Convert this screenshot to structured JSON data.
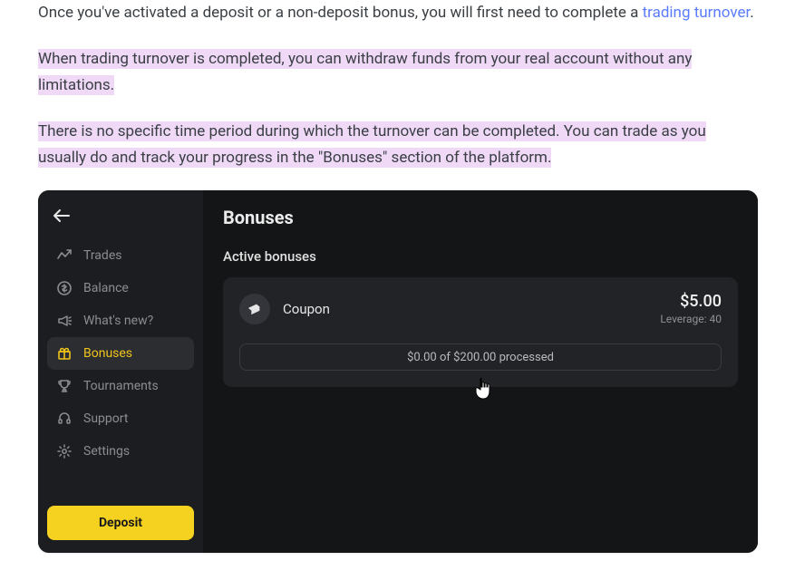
{
  "article": {
    "p1_pre": "Once you've activated a deposit or a non-deposit bonus, you will first need to complete a ",
    "p1_link": "trading turnover",
    "p1_post": ".",
    "p2": "When trading turnover is completed, you can withdraw funds from your real account without any limitations.",
    "p3": "There is no specific time period during which the turnover can be completed. You can trade as you usually do and track your progress in the \"Bonuses\" section of the platform."
  },
  "app": {
    "sidebar": {
      "items": [
        {
          "label": "Trades"
        },
        {
          "label": "Balance"
        },
        {
          "label": "What's new?"
        },
        {
          "label": "Bonuses"
        },
        {
          "label": "Tournaments"
        },
        {
          "label": "Support"
        },
        {
          "label": "Settings"
        }
      ],
      "deposit_label": "Deposit"
    },
    "page_title": "Bonuses",
    "section_title": "Active bonuses",
    "bonus": {
      "name": "Coupon",
      "amount": "$5.00",
      "leverage": "Leverage: 40",
      "progress_text": "$0.00 of $200.00 processed"
    }
  }
}
